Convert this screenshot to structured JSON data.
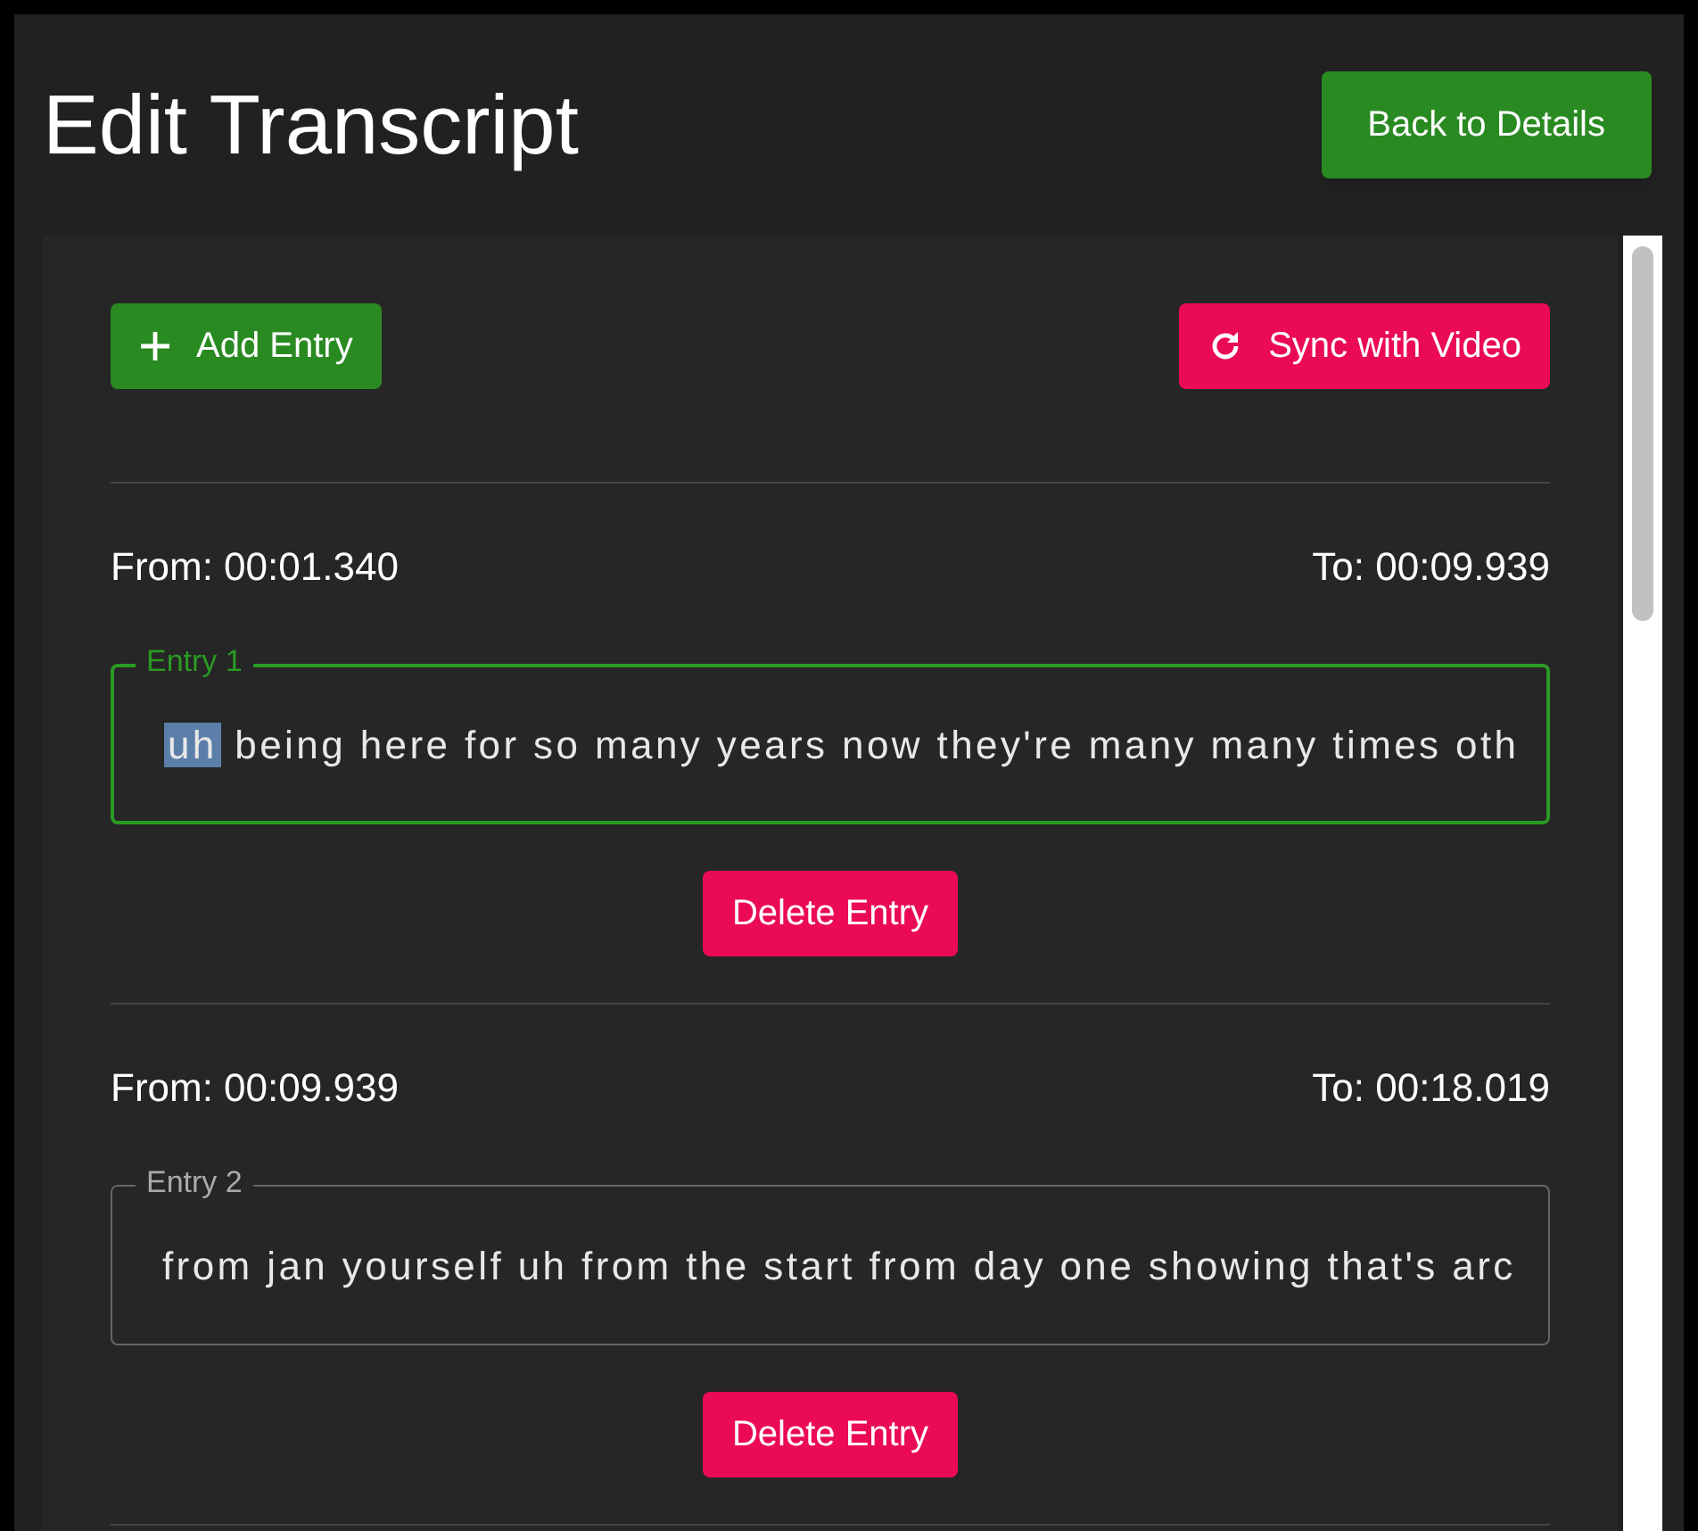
{
  "title": "Edit Transcript",
  "back_button": "Back to Details",
  "toolbar": {
    "add_button": "Add Entry",
    "sync_button": "Sync with Video"
  },
  "entries": [
    {
      "from": "From: 00:01.340",
      "to": "To: 00:09.939",
      "label": "Entry 1",
      "focused": true,
      "selected_text": "uh",
      "value": " being here for so many years now they're many many times oth",
      "delete_button": "Delete Entry"
    },
    {
      "from": "From: 00:09.939",
      "to": "To: 00:18.019",
      "label": "Entry 2",
      "focused": false,
      "value": "from jan yourself uh from the start from day one showing that's arc",
      "delete_button": "Delete Entry"
    }
  ]
}
